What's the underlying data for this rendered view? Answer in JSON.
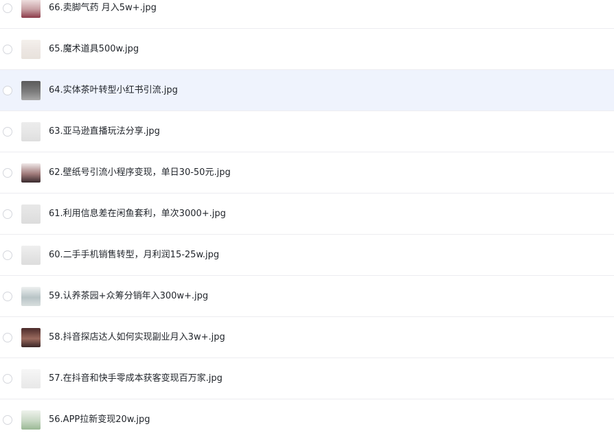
{
  "files": [
    {
      "name": "66.卖脚气药 月入5w+.jpg",
      "selected": false,
      "thumb_colors": [
        "#f2e6e6",
        "#c8a0a4",
        "#8c3a48"
      ]
    },
    {
      "name": "65.魔术道具500w.jpg",
      "selected": false,
      "thumb_colors": [
        "#f4f0ec",
        "#ece6e2",
        "#e8e2dc"
      ]
    },
    {
      "name": "64.实体茶叶转型小红书引流.jpg",
      "selected": true,
      "thumb_colors": [
        "#5a5a5a",
        "#7c7c7c",
        "#a8a8a8"
      ]
    },
    {
      "name": "63.亚马逊直播玩法分享.jpg",
      "selected": false,
      "thumb_colors": [
        "#ececec",
        "#e6e6e6",
        "#dedede"
      ]
    },
    {
      "name": "62.壁纸号引流小程序变现，单日30-50元.jpg",
      "selected": false,
      "thumb_colors": [
        "#f0e8e8",
        "#a07a7a",
        "#3a2a2e"
      ]
    },
    {
      "name": "61.利用信息差在闲鱼套利，单次3000+.jpg",
      "selected": false,
      "thumb_colors": [
        "#e8e8e8",
        "#e2e2e2",
        "#dcdcdc"
      ]
    },
    {
      "name": "60.二手手机销售转型，月利润15-25w.jpg",
      "selected": false,
      "thumb_colors": [
        "#efefef",
        "#e4e4e4",
        "#dddddd"
      ]
    },
    {
      "name": "59.认养茶园+众筹分销年入300w+.jpg",
      "selected": false,
      "thumb_colors": [
        "#eef0f0",
        "#b8c4c6",
        "#d8dede"
      ]
    },
    {
      "name": "58.抖音探店达人如何实现副业月入3w+.jpg",
      "selected": false,
      "thumb_colors": [
        "#4a2a2a",
        "#9a6a5e",
        "#3a2626"
      ]
    },
    {
      "name": "57.在抖音和快手零成本获客变现百万家.jpg",
      "selected": false,
      "thumb_colors": [
        "#f6f6f6",
        "#eeeeee",
        "#e8e8e8"
      ]
    },
    {
      "name": "56.APP拉新变现20w.jpg",
      "selected": false,
      "thumb_colors": [
        "#eef2ec",
        "#c8d8c4",
        "#9ab894"
      ]
    }
  ]
}
